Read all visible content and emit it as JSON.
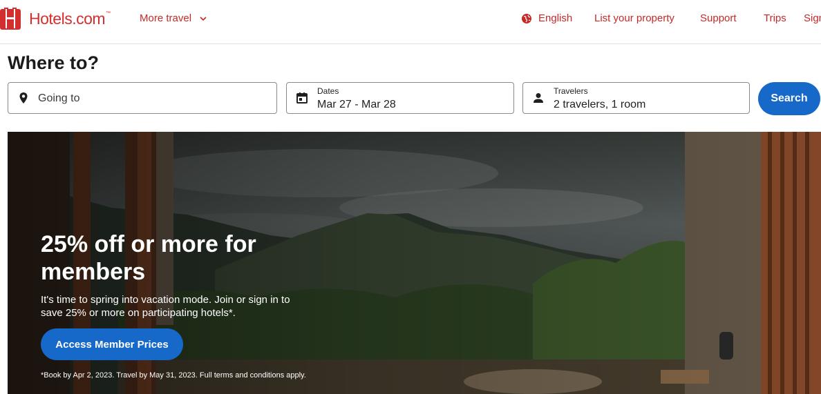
{
  "header": {
    "brand": "Hotels.com",
    "brand_tm": "™",
    "more_travel": "More travel",
    "language": "English",
    "list_property": "List your property",
    "support": "Support",
    "trips": "Trips",
    "sign_in": "Sign in"
  },
  "search": {
    "heading": "Where to?",
    "going_to": {
      "placeholder": "Going to",
      "icon": "map-pin-icon"
    },
    "dates": {
      "label": "Dates",
      "value": "Mar 27 - Mar 28",
      "icon": "calendar-icon"
    },
    "travelers": {
      "label": "Travelers",
      "value": "2 travelers, 1 room",
      "icon": "person-icon"
    },
    "button": "Search"
  },
  "hero": {
    "title": "25% off or more for members",
    "description": "It's time to spring into vacation mode. Join or sign in to save 25% or more on participating hotels*.",
    "cta": "Access Member Prices",
    "fine_print": "*Book by Apr 2, 2023. Travel by May 31, 2023. Full terms and conditions apply."
  },
  "colors": {
    "brand_red": "#d32f2f",
    "link_red": "#c62828",
    "primary_blue": "#1668c9"
  }
}
